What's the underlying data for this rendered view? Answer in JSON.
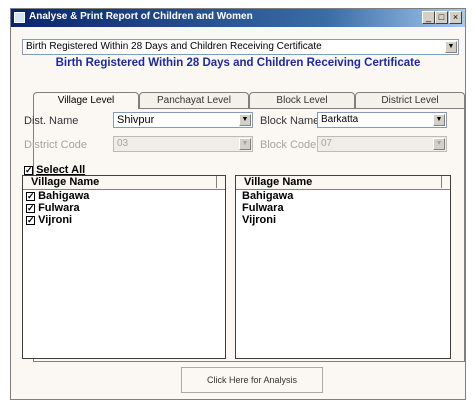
{
  "window": {
    "title": "Analyse & Print Report of Children and Women",
    "minimize_label": "_",
    "maximize_label": "□",
    "close_label": "×"
  },
  "report_select": {
    "value": "Birth Registered Within 28 Days and Children Receiving Certificate"
  },
  "headline": "Birth Registered Within 28 Days and Children Receiving Certificate",
  "tabs": [
    {
      "label": "Village Level",
      "active": true
    },
    {
      "label": "Panchayat Level",
      "active": false
    },
    {
      "label": "Block Level",
      "active": false
    },
    {
      "label": "District Level",
      "active": false
    }
  ],
  "form": {
    "dist_name_label": "Dist. Name",
    "dist_name_value": "Shivpur",
    "block_name_label": "Block Name",
    "block_name_value": "Barkatta",
    "district_code_label": "District Code",
    "district_code_value": "03",
    "block_code_label": "Block Code",
    "block_code_value": "07"
  },
  "select_all": {
    "label": "Select All",
    "checked": true
  },
  "left_list": {
    "header": "Village Name",
    "items": [
      {
        "label": "Bahigawa",
        "checked": true
      },
      {
        "label": "Fulwara",
        "checked": true
      },
      {
        "label": "Vijroni",
        "checked": true
      }
    ]
  },
  "right_list": {
    "header": "Village Name",
    "items": [
      "Bahigawa",
      "Fulwara",
      "Vijroni"
    ]
  },
  "analyse_button": "Click Here for Analysis",
  "check_glyph": "✓"
}
